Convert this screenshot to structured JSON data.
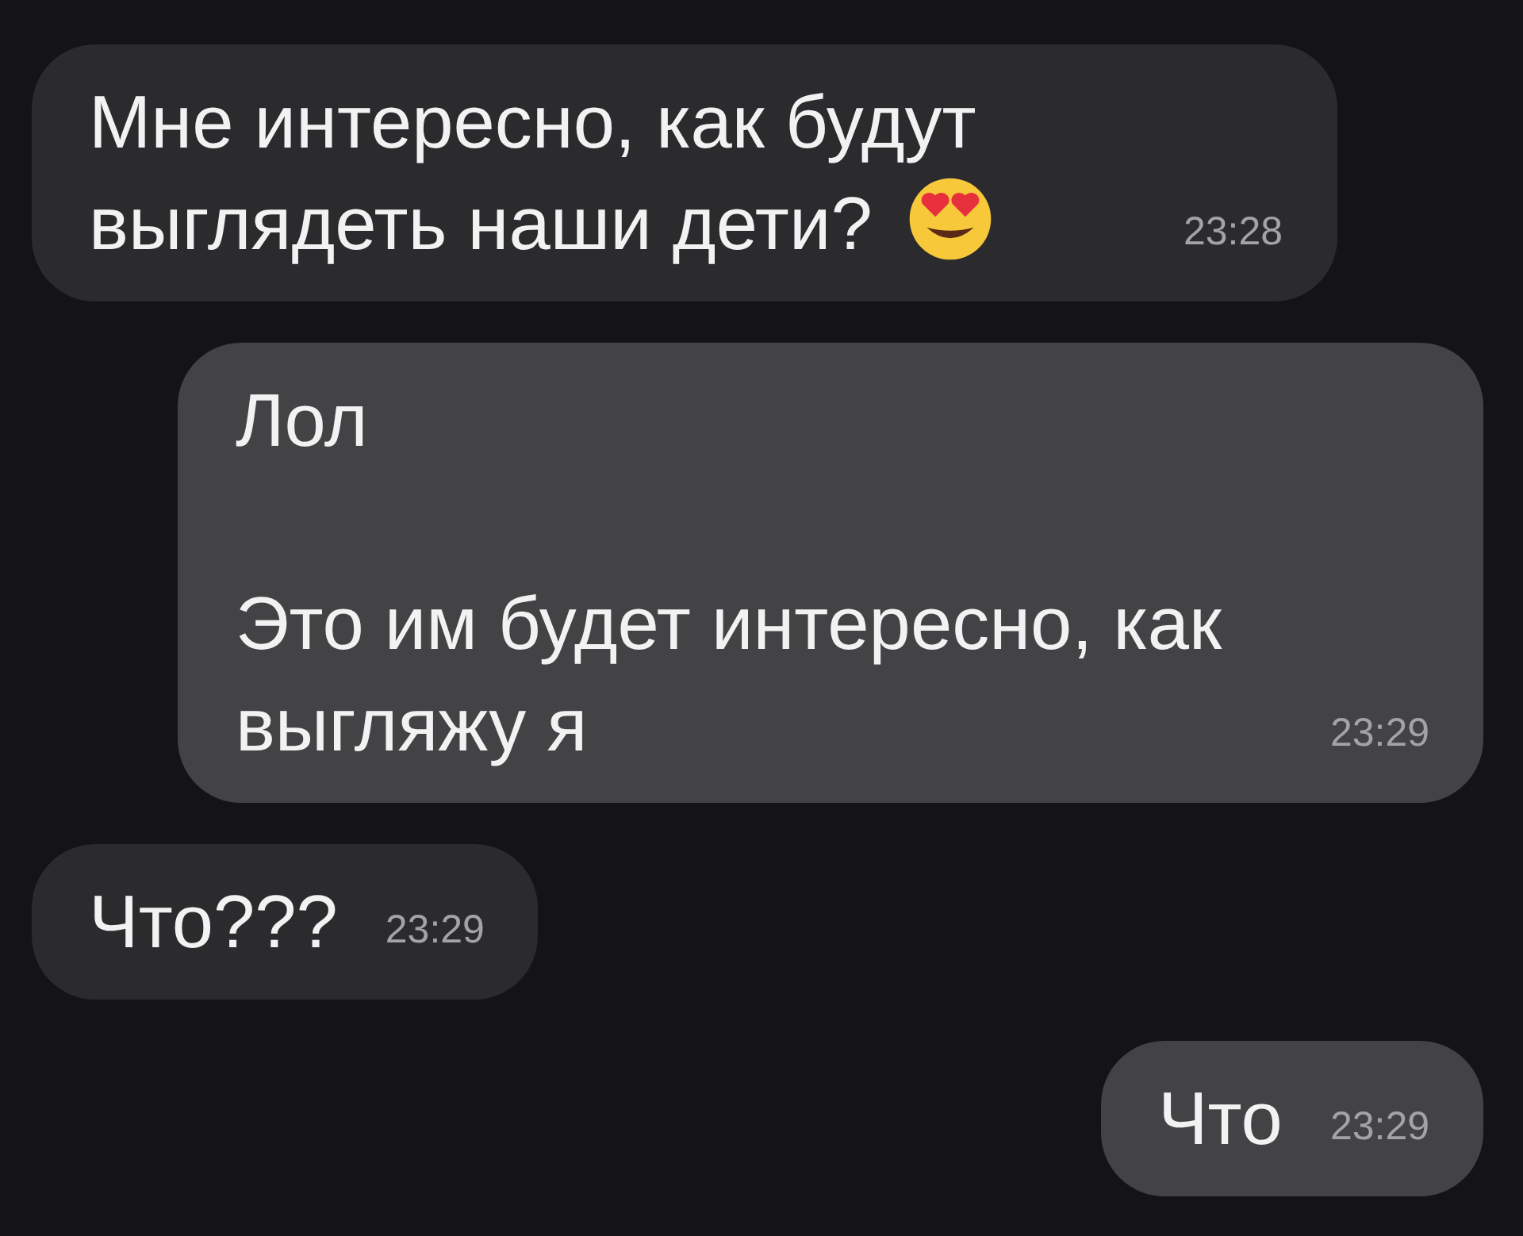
{
  "messages": [
    {
      "outgoing": false,
      "text": "Мне интересно, как будут выглядеть наши дети?",
      "emoji_icon": true,
      "time": "23:28"
    },
    {
      "outgoing": true,
      "text": "Лол\n\nЭто им будет интересно, как выгляжу я",
      "emoji_icon": false,
      "time": "23:29"
    },
    {
      "outgoing": false,
      "text": "Что???",
      "emoji_icon": false,
      "time": "23:29"
    },
    {
      "outgoing": true,
      "text": "Что",
      "emoji_icon": false,
      "time": "23:29"
    }
  ]
}
